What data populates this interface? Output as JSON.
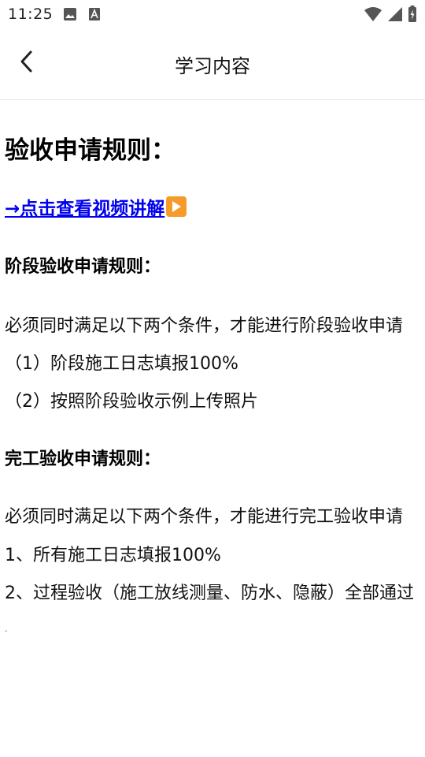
{
  "status_bar": {
    "time": "11:25",
    "icons_left": [
      "image-icon",
      "text-a-icon"
    ],
    "icons_right": [
      "wifi-icon",
      "cell-signal-icon",
      "battery-charging-icon"
    ]
  },
  "app_bar": {
    "title": "学习内容",
    "back_icon": "chevron-left-icon"
  },
  "content": {
    "heading": "验收申请规则：",
    "video_link": "→点击查看视频讲解",
    "stage": {
      "title": "阶段验收申请规则：",
      "intro": "必须同时满足以下两个条件，才能进行阶段验收申请",
      "items": [
        "（1）阶段施工日志填报100%",
        "（2）按照阶段验收示例上传照片"
      ]
    },
    "completion": {
      "title": "完工验收申请规则：",
      "intro": "必须同时满足以下两个条件，才能进行完工验收申请",
      "items": [
        "1、所有施工日志填报100%",
        "2、过程验收（施工放线测量、防水、隐蔽）全部通过"
      ]
    },
    "tail_mark": "''"
  },
  "colors": {
    "link": "#0000ee",
    "play_badge": "#f59b2a",
    "divider": "#e6e6e6"
  }
}
